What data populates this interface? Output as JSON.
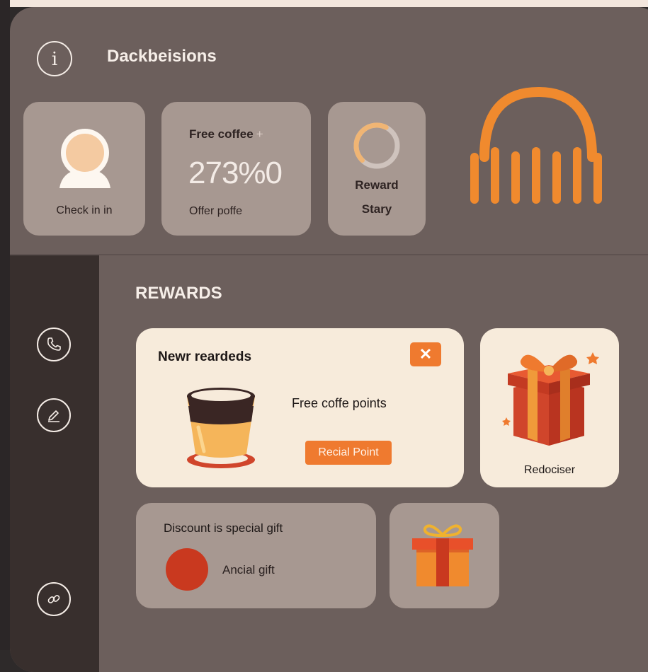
{
  "header": {
    "title": "Dackbeisions",
    "info_icon": "info-icon"
  },
  "tiles": {
    "check_in": {
      "label": "Check in in",
      "icon": "user-avatar-icon"
    },
    "free_coffee": {
      "title": "Free coffee",
      "plus": "+",
      "value": "273%0",
      "subtitle": "Offer poffe"
    },
    "reward": {
      "line1": "Reward",
      "line2": "Stary",
      "progress": 0.5
    }
  },
  "rewards": {
    "section_title": "REWARDS",
    "new_card": {
      "title": "Newr reardeds",
      "close_label": "✕",
      "points_text": "Free coffe points",
      "button_label": "Recial Point"
    },
    "gift_card": {
      "label": "Redociser"
    },
    "discount_card": {
      "title": "Discount is special gift",
      "label": "Ancial gift"
    }
  },
  "sidebar": {
    "icons": [
      "phone-icon",
      "edit-icon",
      "link-icon"
    ]
  },
  "colors": {
    "accent": "#ef7a2f",
    "panel": "#6c5f5c",
    "tile": "#a79891",
    "card": "#f7ebdb",
    "sidebar": "#382f2d"
  }
}
